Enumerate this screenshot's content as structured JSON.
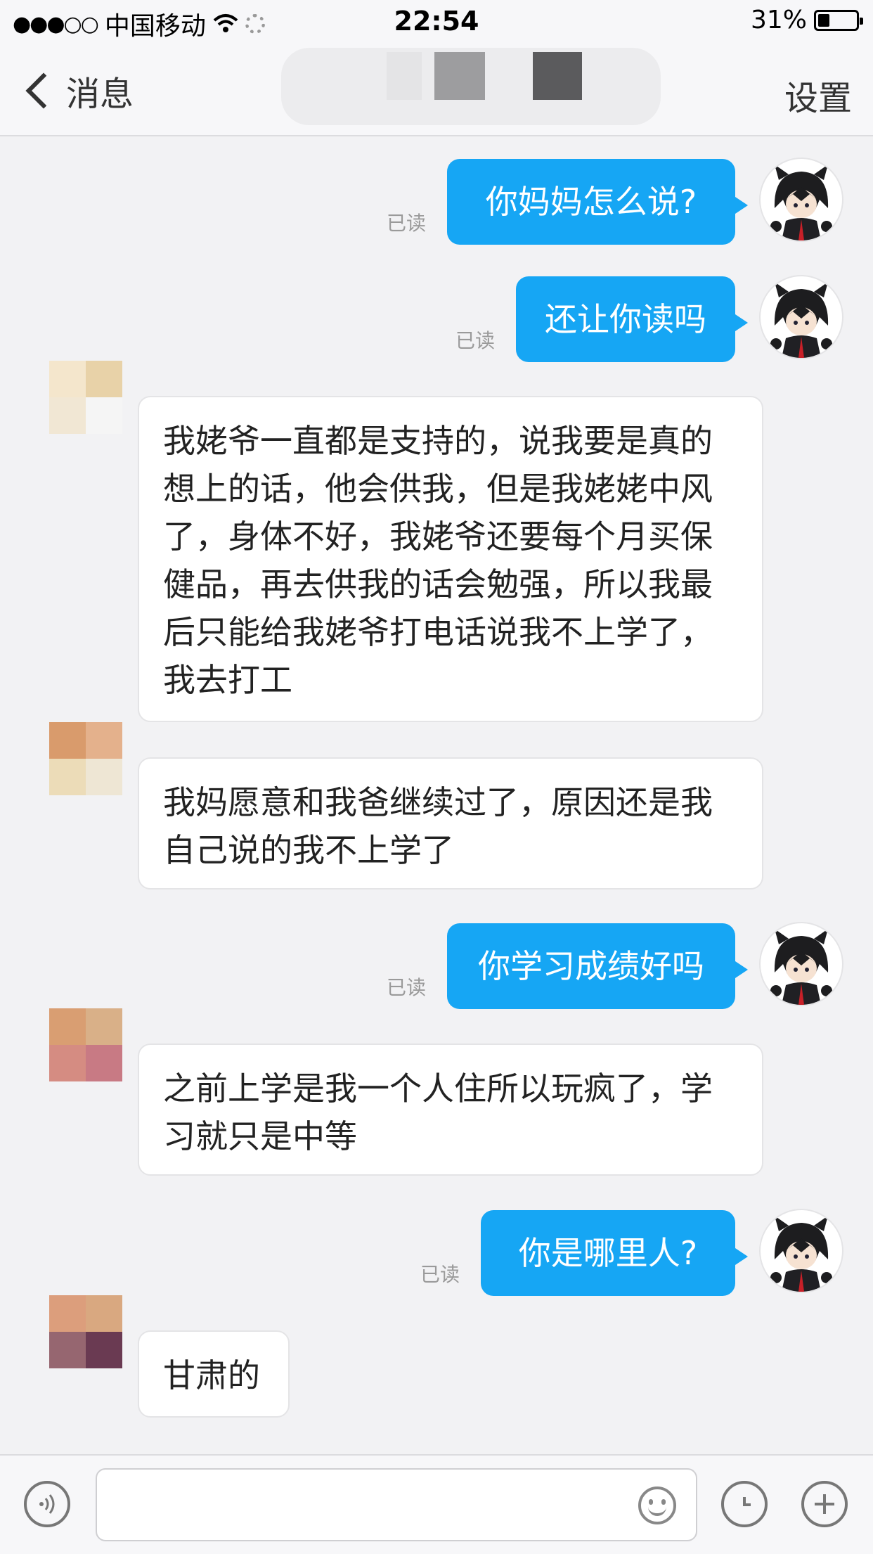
{
  "status_bar": {
    "signal": "●●●○○",
    "carrier": "中国移动",
    "time": "22:54",
    "battery": "31%",
    "battery_level": 0.31
  },
  "nav": {
    "back_label": "消息",
    "settings_label": "设置"
  },
  "messages": [
    {
      "dir": "out",
      "text": "你妈妈怎么说?",
      "read": "已读"
    },
    {
      "dir": "out",
      "text": "还让你读吗",
      "read": "已读"
    },
    {
      "dir": "in",
      "lines": [
        "我姥爷一直都是支持的，说我要是真的",
        "想上的话，他会供我，但是我姥姥中风",
        "了，身体不好，我姥爷还要每个月买保",
        "健品，再去供我的话会勉强，所以我最",
        "后只能给我姥爷打电话说我不上学了，",
        "我去打工"
      ]
    },
    {
      "dir": "in",
      "lines": [
        "我妈愿意和我爸继续过了，原因还是我",
        "自己说的我不上学了"
      ]
    },
    {
      "dir": "out",
      "text": "你学习成绩好吗",
      "read": "已读"
    },
    {
      "dir": "in",
      "lines": [
        "之前上学是我一个人住所以玩疯了，学",
        "习就只是中等"
      ]
    },
    {
      "dir": "out",
      "text": "你是哪里人?",
      "read": "已读"
    },
    {
      "dir": "in",
      "lines": [
        "甘肃的"
      ]
    }
  ],
  "icons": {
    "voice": "voice-icon",
    "emoji": "emoji-icon",
    "clock": "clock-icon",
    "plus": "plus-icon",
    "back": "chevron-left-icon"
  },
  "colors": {
    "outgoing_bubble": "#16a6f4",
    "background": "#f2f2f4"
  }
}
